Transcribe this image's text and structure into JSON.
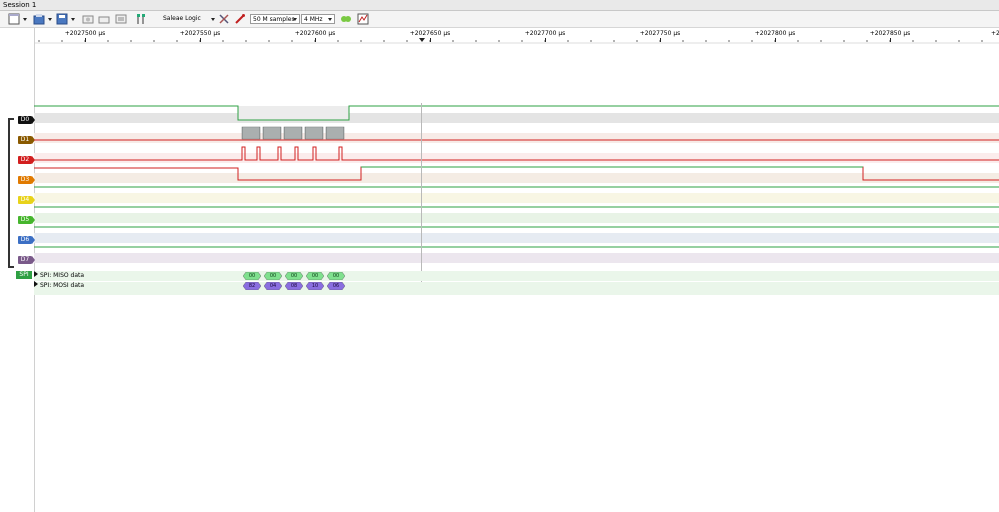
{
  "window": {
    "title": "Session 1"
  },
  "toolbar": {
    "device": "Saleae Logic",
    "samples": "50 M samples",
    "rate": "4 MHz"
  },
  "ruler": {
    "ticks": [
      {
        "label": "+2027500 µs"
      },
      {
        "label": "+2027550 µs"
      },
      {
        "label": "+2027600 µs"
      },
      {
        "label": "+2027650 µs"
      },
      {
        "label": "+2027700 µs"
      },
      {
        "label": "+2027750 µs"
      },
      {
        "label": "+2027800 µs"
      },
      {
        "label": "+2027850 µs"
      },
      {
        "label": "+202"
      }
    ]
  },
  "channels": [
    {
      "label": "D0",
      "color": "#111111"
    },
    {
      "label": "D1",
      "color": "#8a5a00"
    },
    {
      "label": "D2",
      "color": "#d21f1f"
    },
    {
      "label": "D3",
      "color": "#e07a00"
    },
    {
      "label": "D4",
      "color": "#e8d21a"
    },
    {
      "label": "D5",
      "color": "#46b52d"
    },
    {
      "label": "D6",
      "color": "#3c6fc4"
    },
    {
      "label": "D7",
      "color": "#7a5a8a"
    }
  ],
  "spi": {
    "label": "SPI",
    "miso": {
      "name": "SPI: MISO data",
      "values": [
        "00",
        "00",
        "00",
        "00",
        "00"
      ]
    },
    "mosi": {
      "name": "SPI: MOSI data",
      "values": [
        "82",
        "04",
        "08",
        "10",
        "06"
      ]
    },
    "miso_color": "#7fe08e",
    "mosi_color": "#8a6ee0"
  }
}
